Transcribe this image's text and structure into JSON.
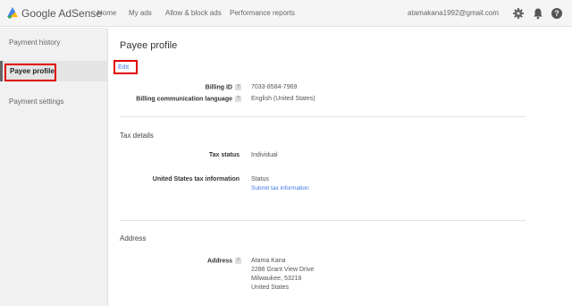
{
  "header": {
    "app_name": "Google AdSense",
    "nav": [
      "Home",
      "My ads",
      "Allow & block ads",
      "Performance reports"
    ],
    "account_email": "atamakana1992@gmail.com",
    "icons": [
      "settings-icon",
      "notifications-icon",
      "help-icon"
    ]
  },
  "sidebar": {
    "items": [
      "Payment history",
      "Payee profile",
      "Payment settings"
    ],
    "active": "Payee profile"
  },
  "main": {
    "title": "Payee profile",
    "edit_label": "Edit",
    "billing": {
      "billing_id_label": "Billing ID",
      "billing_id_value": "7033-8584-7969",
      "language_label": "Billing communication language",
      "language_value": "English (United States)"
    },
    "tax": {
      "section_title": "Tax details",
      "status_label": "Tax status",
      "status_value": "Individual",
      "us_info_label": "United States tax information",
      "us_info_value": "Status",
      "us_info_link": "Submit tax information"
    },
    "address": {
      "section_title": "Address",
      "label": "Address",
      "lines": [
        "Atama Kana",
        "2286 Grant View Drive",
        "Milwaukee, 53218",
        "United States"
      ]
    }
  },
  "colors": {
    "link": "#3b78e7",
    "highlight": "#e00000",
    "logo_yellow": "#fbbc04",
    "logo_blue": "#4285f4"
  }
}
